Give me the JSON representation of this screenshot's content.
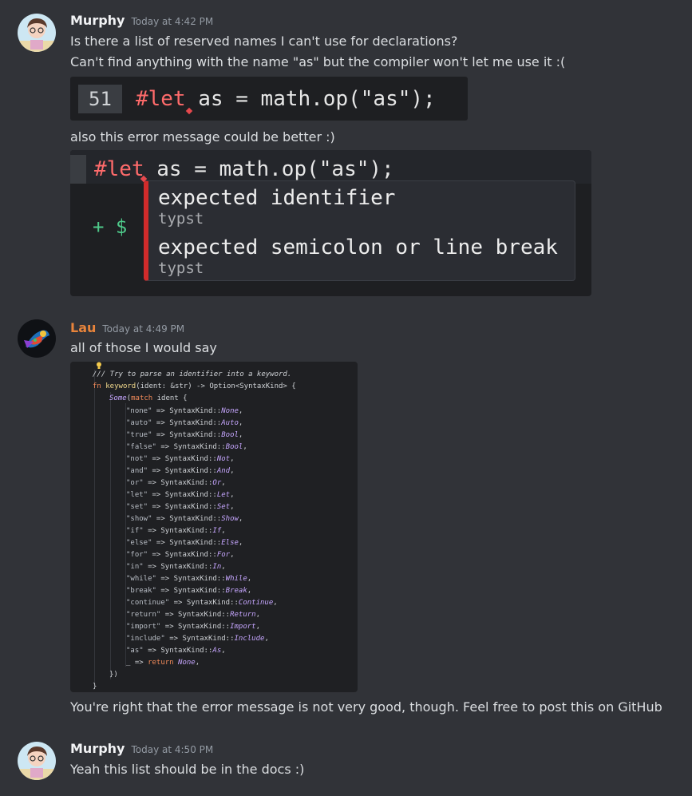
{
  "messages": [
    {
      "username": "Murphy",
      "timestamp": "Today at 4:42 PM",
      "lines": [
        "Is there a list of reserved names I can't use for declarations?",
        "Can't find anything with the name \"as\" but the compiler won't let me use it :("
      ],
      "image1": {
        "line_number": "51",
        "keyword": "#let",
        "code_rest": " as = math.op(\"as\");"
      },
      "caption": "also this error message could be better :)",
      "image2": {
        "keyword": "#let",
        "code_rest": " as = math.op(\"as\");",
        "prompt": "+ $",
        "error1": "expected identifier",
        "source1": "typst",
        "error2": "expected semicolon or line break",
        "source2": "typst"
      }
    },
    {
      "username": "Lau",
      "username_color": "#e8843b",
      "timestamp": "Today at 4:49 PM",
      "text": "all of those I would say",
      "code": {
        "comment": "/// Try to parse an identifier into a keyword.",
        "signature_fn": "fn",
        "signature_name": "keyword",
        "signature_rest": "(ident: &str) -> Option<SyntaxKind> {",
        "some_open_some": "Some",
        "some_open_match": "match",
        "some_open_rest": " ident {",
        "arms": [
          {
            "key": "\"none\"",
            "kind": "None"
          },
          {
            "key": "\"auto\"",
            "kind": "Auto"
          },
          {
            "key": "\"true\"",
            "kind": "Bool"
          },
          {
            "key": "\"false\"",
            "kind": "Bool"
          },
          {
            "key": "\"not\"",
            "kind": "Not"
          },
          {
            "key": "\"and\"",
            "kind": "And"
          },
          {
            "key": "\"or\"",
            "kind": "Or"
          },
          {
            "key": "\"let\"",
            "kind": "Let"
          },
          {
            "key": "\"set\"",
            "kind": "Set"
          },
          {
            "key": "\"show\"",
            "kind": "Show"
          },
          {
            "key": "\"if\"",
            "kind": "If"
          },
          {
            "key": "\"else\"",
            "kind": "Else"
          },
          {
            "key": "\"for\"",
            "kind": "For"
          },
          {
            "key": "\"in\"",
            "kind": "In"
          },
          {
            "key": "\"while\"",
            "kind": "While"
          },
          {
            "key": "\"break\"",
            "kind": "Break"
          },
          {
            "key": "\"continue\"",
            "kind": "Continue"
          },
          {
            "key": "\"return\"",
            "kind": "Return"
          },
          {
            "key": "\"import\"",
            "kind": "Import"
          },
          {
            "key": "\"include\"",
            "kind": "Include"
          },
          {
            "key": "\"as\"",
            "kind": "As"
          }
        ],
        "arrow": "=>",
        "kind_prefix": "SyntaxKind::",
        "default_arm": "_ => ",
        "default_return": "return",
        "default_value": "None",
        "close_match": "})",
        "close_fn": "}"
      },
      "followup": "You're right that the error message is not very good, though. Feel free to post this on GitHub"
    },
    {
      "username": "Murphy",
      "timestamp": "Today at 4:50 PM",
      "text": "Yeah this list should be in the docs :)"
    }
  ],
  "colors": {
    "background": "#313338",
    "error_red": "#d12b2b",
    "lau_name": "#e8843b"
  }
}
